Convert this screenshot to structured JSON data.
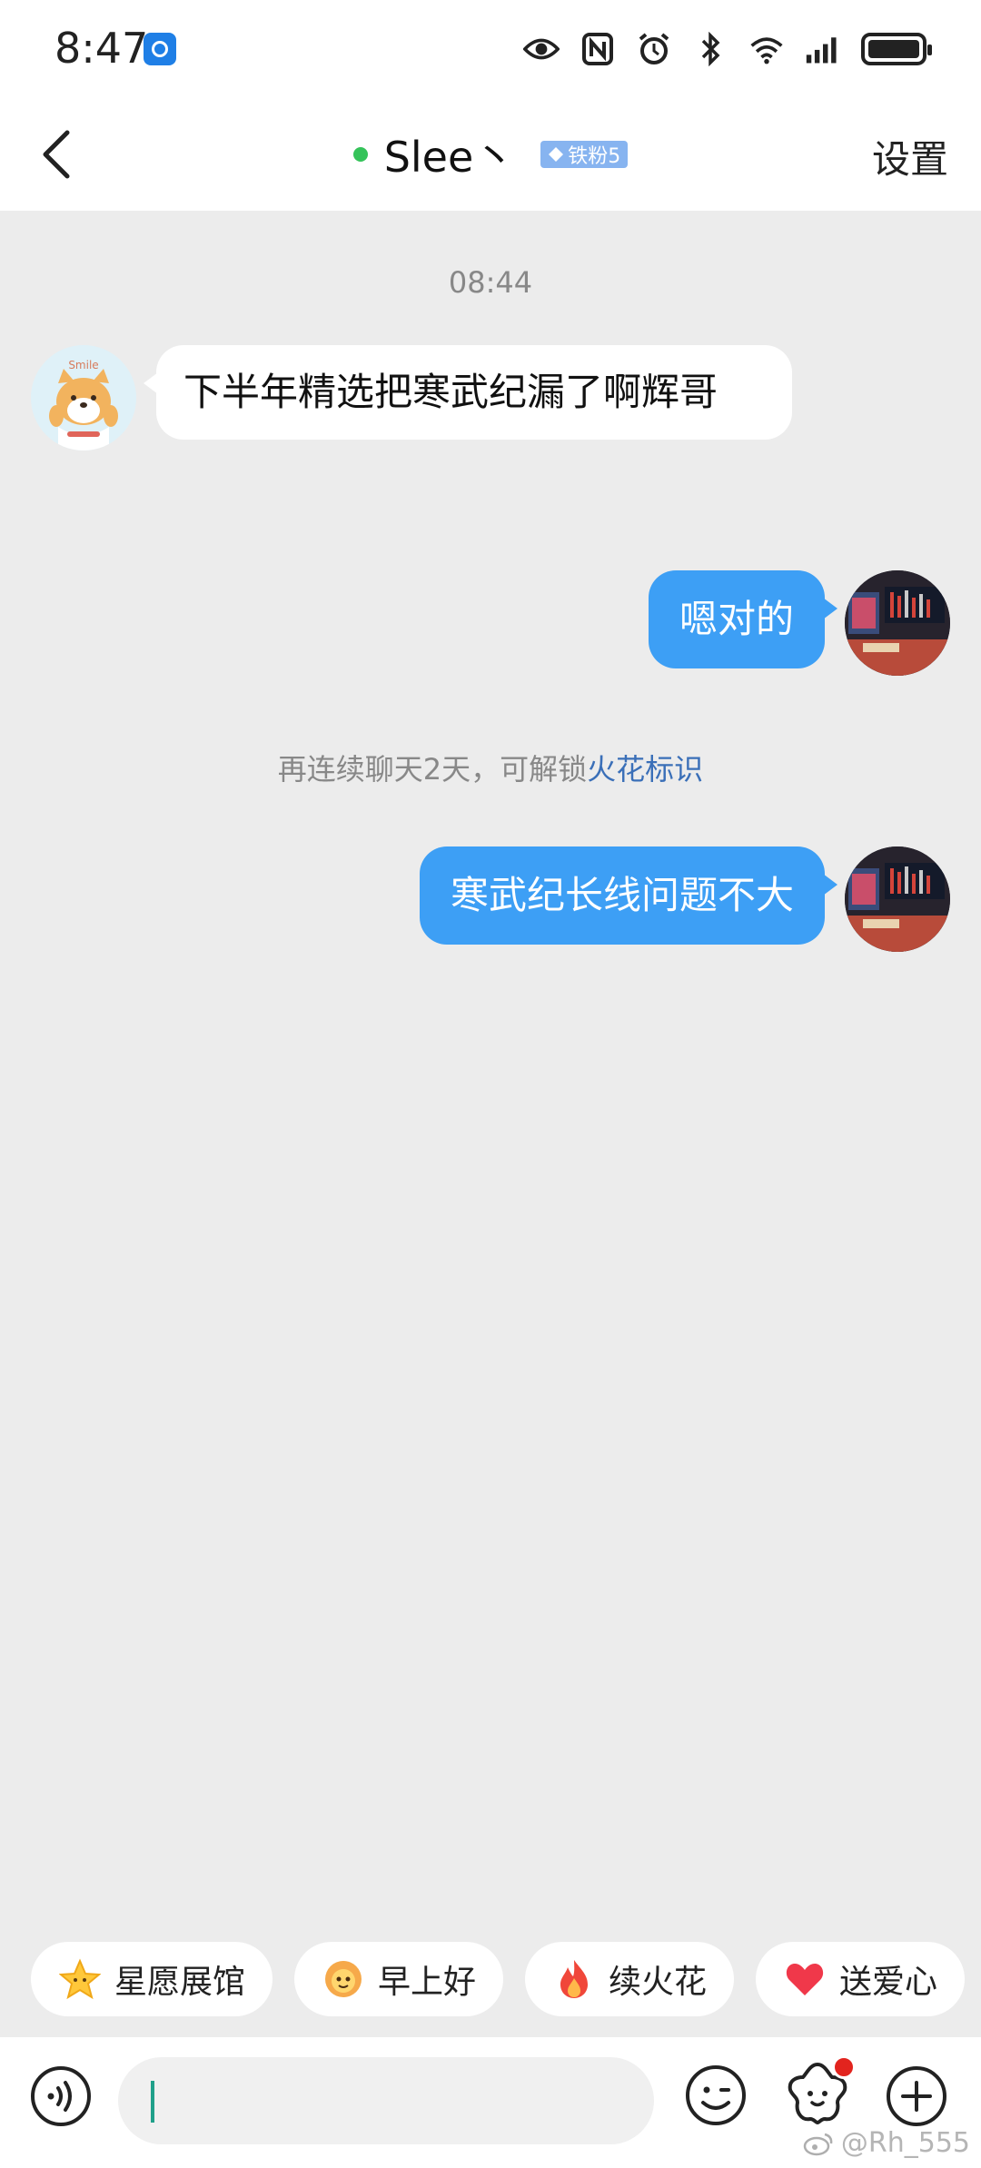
{
  "status_bar": {
    "time": "8:47",
    "app_icon": "notification-app-icon",
    "icons": [
      "eye-icon",
      "nfc-icon",
      "alarm-icon",
      "bluetooth-icon",
      "wifi-icon",
      "signal-icon",
      "battery-icon"
    ]
  },
  "header": {
    "contact_name": "Slee丶",
    "online": true,
    "badge_label": "铁粉5",
    "settings_label": "设置"
  },
  "chat": {
    "timestamp": "08:44",
    "messages": [
      {
        "direction": "incoming",
        "text": "下半年精选把寒武纪漏了啊辉哥"
      },
      {
        "direction": "outgoing",
        "text": "嗯对的"
      },
      {
        "direction": "outgoing",
        "text": "寒武纪长线问题不大"
      }
    ],
    "system_hint": {
      "prefix": "再连续聊天2天，可解锁",
      "link": "火花标识"
    },
    "avatar_text": "Smile"
  },
  "quick_replies": [
    {
      "label": "星愿展馆",
      "icon": "star-icon"
    },
    {
      "label": "早上好",
      "icon": "sun-face-icon"
    },
    {
      "label": "续火花",
      "icon": "fire-icon"
    },
    {
      "label": "送爱心",
      "icon": "heart-icon"
    }
  ],
  "input": {
    "value": "",
    "placeholder": ""
  },
  "watermark": "@Rh_555",
  "colors": {
    "accent_blue": "#3d9ff5",
    "background": "#ececec",
    "online_green": "#35c35a",
    "link_blue": "#3a6fb8"
  }
}
